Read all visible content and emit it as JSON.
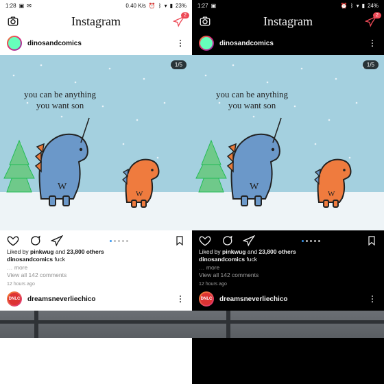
{
  "status_left": {
    "time": "1:28",
    "time_dark": "1:27"
  },
  "status_right": {
    "net": "0.40 K/s",
    "batt": "23%",
    "batt_dark": "24%"
  },
  "header": {
    "brand": "Instagram",
    "dm_badge": "2"
  },
  "post": {
    "username": "dinosandcomics",
    "counter": "1/5",
    "comic_text_line1": "you can be anything",
    "comic_text_line2": "you want son",
    "liked_prefix": "Liked by ",
    "liked_user": "pinkwug",
    "liked_mid": " and ",
    "liked_count": "23,800 others",
    "caption_user": "dinosandcomics",
    "caption_text": " fuck",
    "more": "… more",
    "view_comments": "View all 142 comments",
    "age": "12 hours ago"
  },
  "next_post": {
    "username": "dreamsneverliechico",
    "avatar_initials": "DNLC"
  }
}
